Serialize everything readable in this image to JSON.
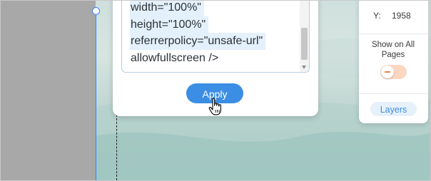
{
  "embed_code": {
    "lines": [
      "width=\"100%\"",
      "height=\"100%\"",
      "referrerpolicy=\"unsafe-url\"",
      "allowfullscreen />"
    ]
  },
  "apply_button": {
    "label": "Apply"
  },
  "side_panel": {
    "y_label": "Y:",
    "y_value": "1958",
    "show_on_all_pages_label": "Show on All Pages",
    "show_on_all_pages_enabled": false,
    "layers_label": "Layers"
  },
  "colors": {
    "accent_blue": "#3b8ee3",
    "selection_blue": "#3b82f6",
    "toggle_off_bg": "#fbd7c2",
    "toggle_off_mark": "#f0833a",
    "code_highlight": "#e4f0fb"
  },
  "icons": {
    "cursor": "hand-pointer-icon",
    "scroll_down": "chevron-down-icon"
  }
}
